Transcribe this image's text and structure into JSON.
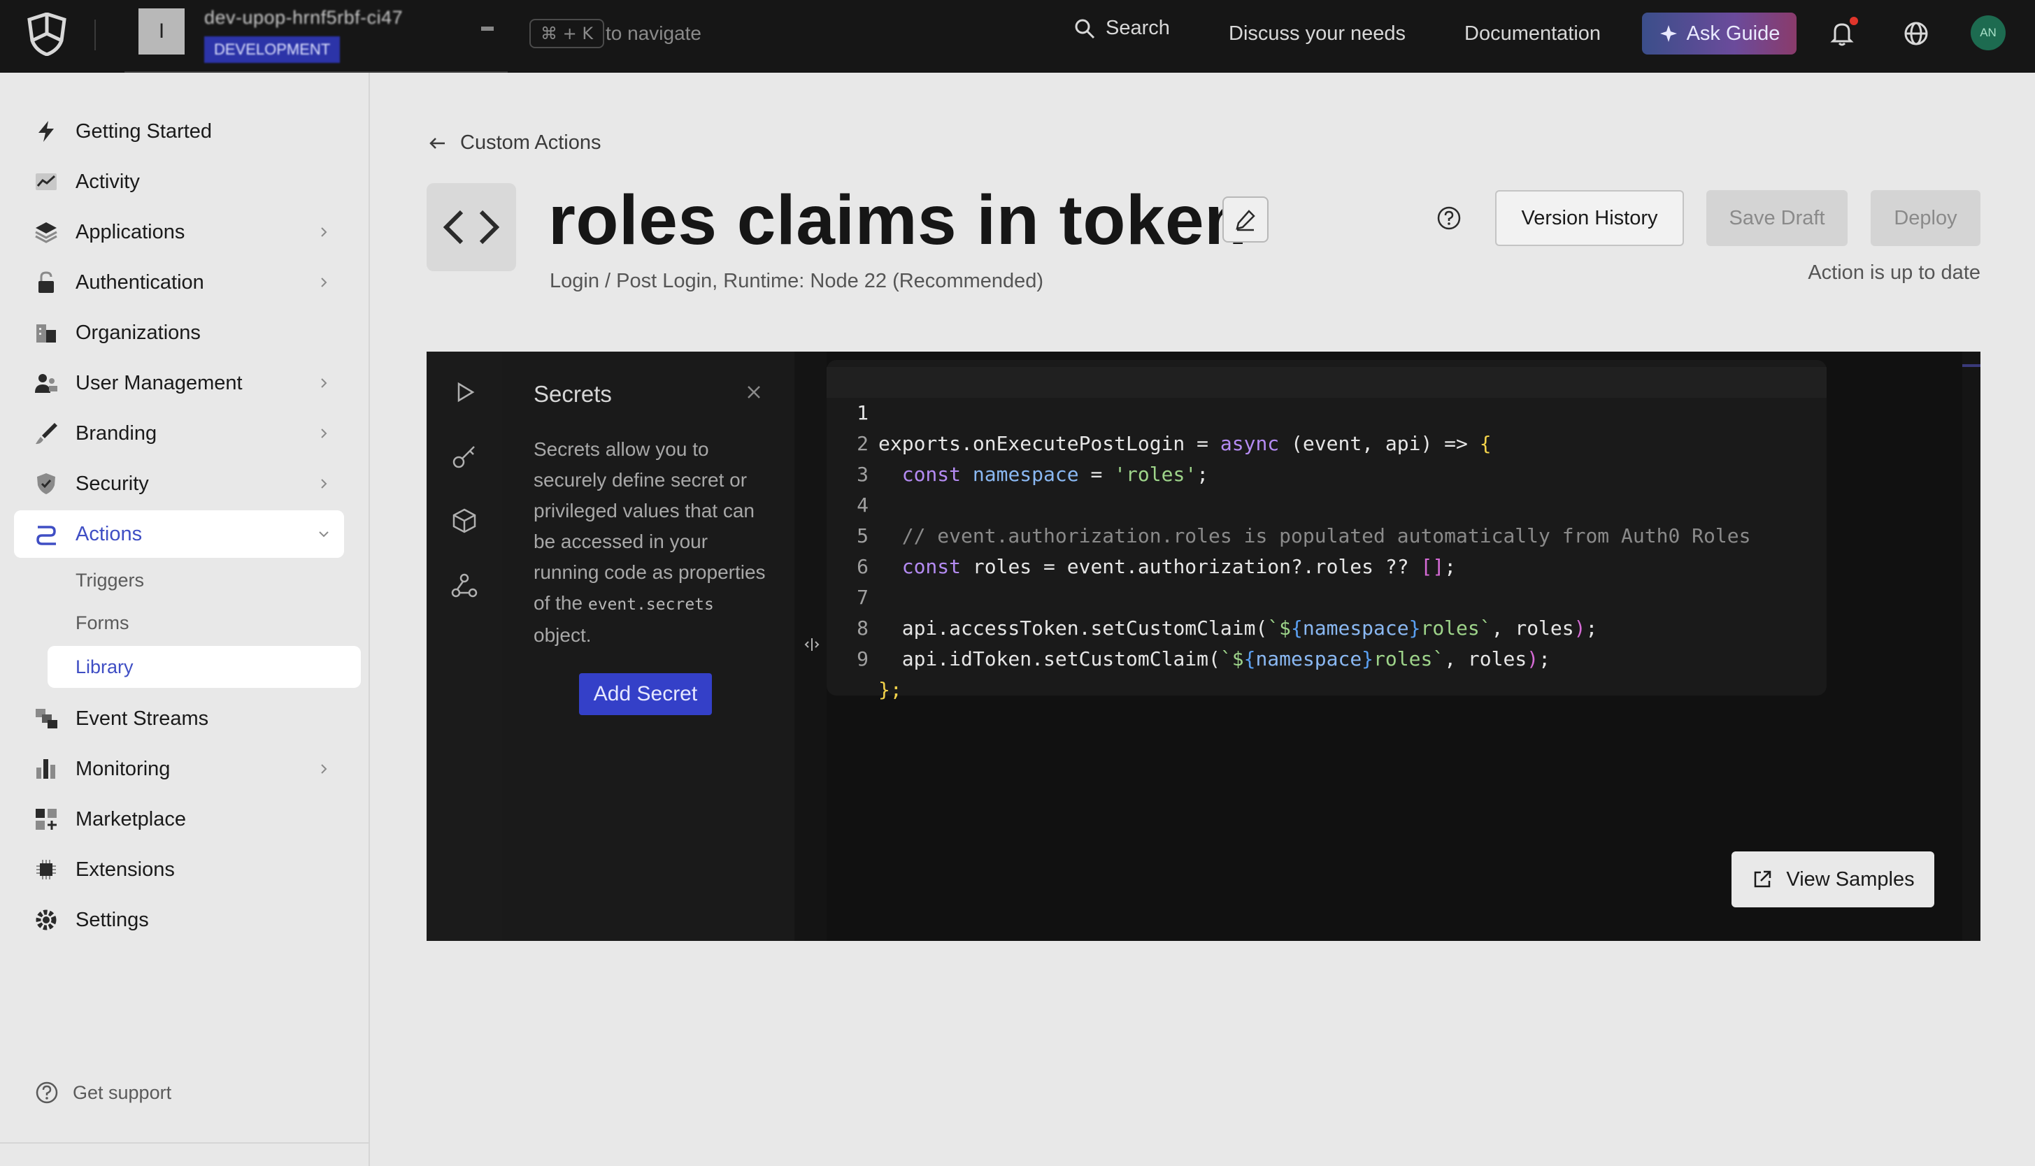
{
  "topbar": {
    "tenant_avatar_letter": "I",
    "tenant_name": "dev-upop-hrnf5rbf-ci47",
    "tenant_env": "DEVELOPMENT",
    "kbd_shortcut": "⌘ + K",
    "kbd_hint": "to navigate",
    "search_label": "Search",
    "discuss_label": "Discuss your needs",
    "docs_label": "Documentation",
    "ask_guide_label": "Ask Guide",
    "user_initials": "AN"
  },
  "sidebar": {
    "items": [
      {
        "label": "Getting Started",
        "icon": "lightning-icon"
      },
      {
        "label": "Activity",
        "icon": "activity-chart-icon"
      },
      {
        "label": "Applications",
        "icon": "layers-icon"
      },
      {
        "label": "Authentication",
        "icon": "lock-icon"
      },
      {
        "label": "Organizations",
        "icon": "building-icon"
      },
      {
        "label": "User Management",
        "icon": "users-icon"
      },
      {
        "label": "Branding",
        "icon": "brush-icon"
      },
      {
        "label": "Security",
        "icon": "shield-icon"
      },
      {
        "label": "Actions",
        "icon": "actions-flow-icon"
      },
      {
        "label": "Event Streams",
        "icon": "event-streams-icon"
      },
      {
        "label": "Monitoring",
        "icon": "bar-chart-icon"
      },
      {
        "label": "Marketplace",
        "icon": "marketplace-icon"
      },
      {
        "label": "Extensions",
        "icon": "chip-icon"
      },
      {
        "label": "Settings",
        "icon": "gear-icon"
      }
    ],
    "actions_sub": [
      "Triggers",
      "Forms",
      "Library"
    ],
    "get_support": "Get support"
  },
  "main": {
    "breadcrumb": "Custom Actions",
    "title": "roles claims in token",
    "subtitle": "Login / Post Login, Runtime: Node 22 (Recommended)",
    "version_history": "Version History",
    "save_draft": "Save Draft",
    "deploy": "Deploy",
    "status": "Action is up to date"
  },
  "secrets": {
    "title": "Secrets",
    "desc_pre": "Secrets allow you to securely define secret or privileged values that can be accessed in your running code as properties of the ",
    "desc_code": "event.secrets",
    "desc_post": " object.",
    "add_button": "Add Secret"
  },
  "code": {
    "line_numbers": [
      "1",
      "2",
      "3",
      "4",
      "5",
      "6",
      "7",
      "8",
      "9"
    ],
    "l1_a": "exports.onExecutePostLogin = ",
    "l1_async": "async",
    "l1_b": " (event, api) => ",
    "l2_const": "const",
    "l2_name": "namespace",
    "l2_eq": " = ",
    "l2_str": "'roles'",
    "l4_comment": "// event.authorization.roles is populated automatically from Auth0 Roles",
    "l5_const": "const",
    "l5_rest": " roles = event.authorization?.roles ?? ",
    "l7_a": "api.accessToken.setCustomClaim(",
    "l8_a": "api.idToken.setCustomClaim(",
    "tpl_ns": "namespace",
    "tpl_roles": "roles`",
    "args_tail": ", roles",
    "l9": "};"
  },
  "view_samples": "View Samples"
}
